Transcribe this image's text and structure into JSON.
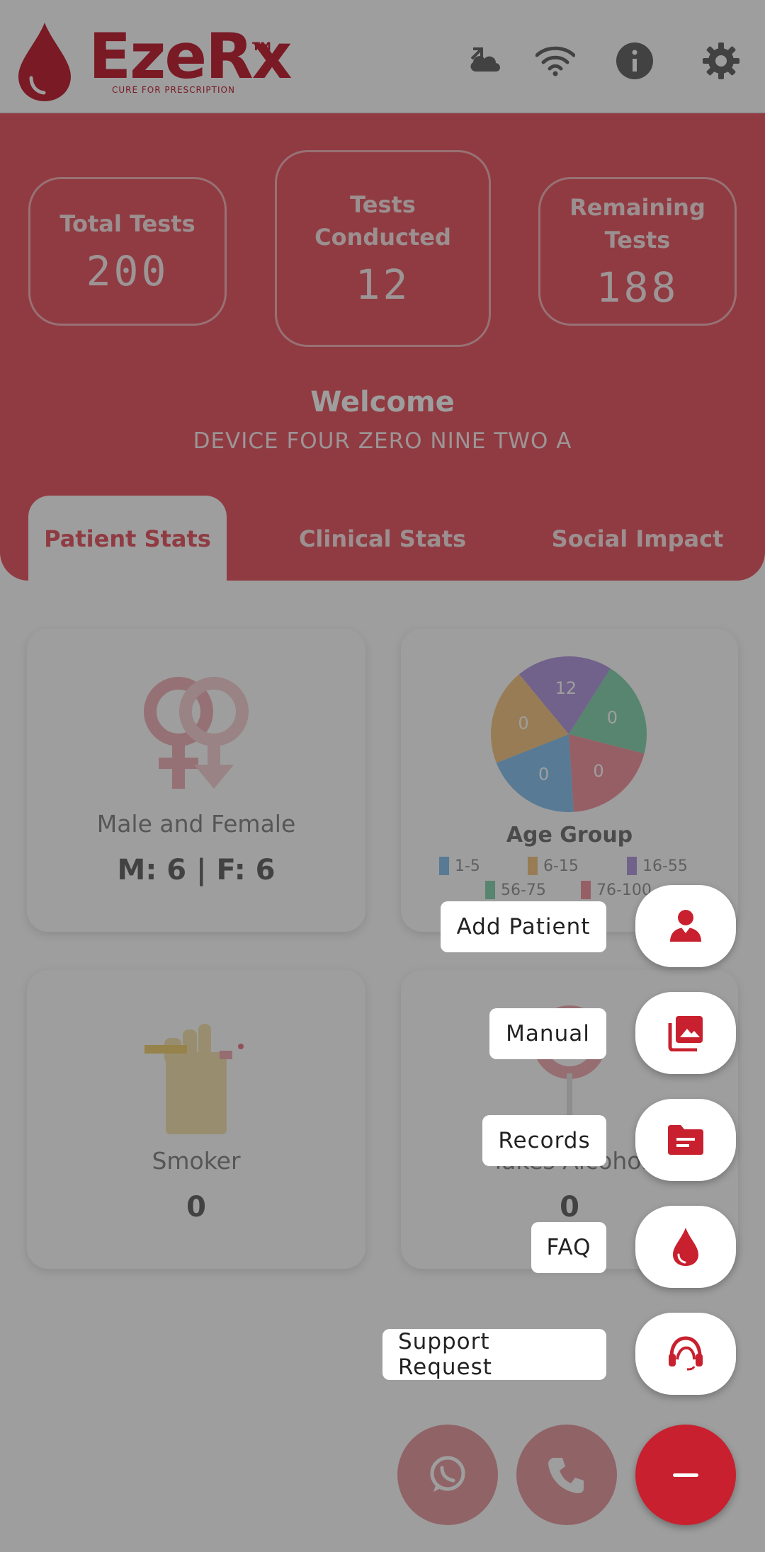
{
  "app": {
    "logo": {
      "name": "EzeRx",
      "tm": "TM",
      "tagline": "CURE FOR PRESCRIPTION"
    }
  },
  "header_icons": [
    "sync-icon",
    "wifi-icon",
    "info-icon",
    "gear-icon"
  ],
  "stats": {
    "total_label": "Total Tests",
    "total_value": "200",
    "conducted_label": "Tests Conducted",
    "conducted_value": "12",
    "remaining_label": "Remaining Tests",
    "remaining_value": "188"
  },
  "welcome": {
    "title": "Welcome",
    "device": "DEVICE FOUR ZERO NINE TWO A"
  },
  "tabs": [
    {
      "label": "Patient Stats",
      "active": true
    },
    {
      "label": "Clinical Stats",
      "active": false
    },
    {
      "label": "Social Impact",
      "active": false
    }
  ],
  "cards": {
    "gender": {
      "title": "Male and Female",
      "value": "M: 6 | F: 6"
    },
    "age": {
      "title": "Age Group",
      "slices": [
        {
          "label": "16-55",
          "value": "12",
          "color": "#b69ee0"
        },
        {
          "label": "56-75",
          "value": "0",
          "color": "#8fd7b3"
        },
        {
          "label": "76-100",
          "value": "0",
          "color": "#f29aa5"
        },
        {
          "label": "1-5",
          "value": "0",
          "color": "#8ec5ef"
        },
        {
          "label": "6-15",
          "value": "0",
          "color": "#f5c98a"
        }
      ],
      "legend": [
        "1-5",
        "6-15",
        "16-55",
        "56-75",
        "76-100"
      ]
    },
    "smoker": {
      "title": "Smoker",
      "value": "0"
    },
    "alcohol": {
      "title": "Takes Alcohol",
      "value": "0"
    }
  },
  "speed_dial": {
    "items": [
      {
        "label": "Add Patient",
        "icon": "person-icon"
      },
      {
        "label": "Manual",
        "icon": "photo-library-icon"
      },
      {
        "label": "Records",
        "icon": "folder-icon"
      },
      {
        "label": "FAQ",
        "icon": "blood-drop-icon"
      },
      {
        "label": "Support Request",
        "icon": "headset-icon"
      }
    ],
    "close_icon": "minus-icon"
  },
  "bottom_buttons": [
    "whatsapp-icon",
    "phone-icon"
  ],
  "colors": {
    "brand_red": "#c8202e",
    "banner": "#e85f6b",
    "overlay": "rgba(0,0,0,0.38)"
  }
}
